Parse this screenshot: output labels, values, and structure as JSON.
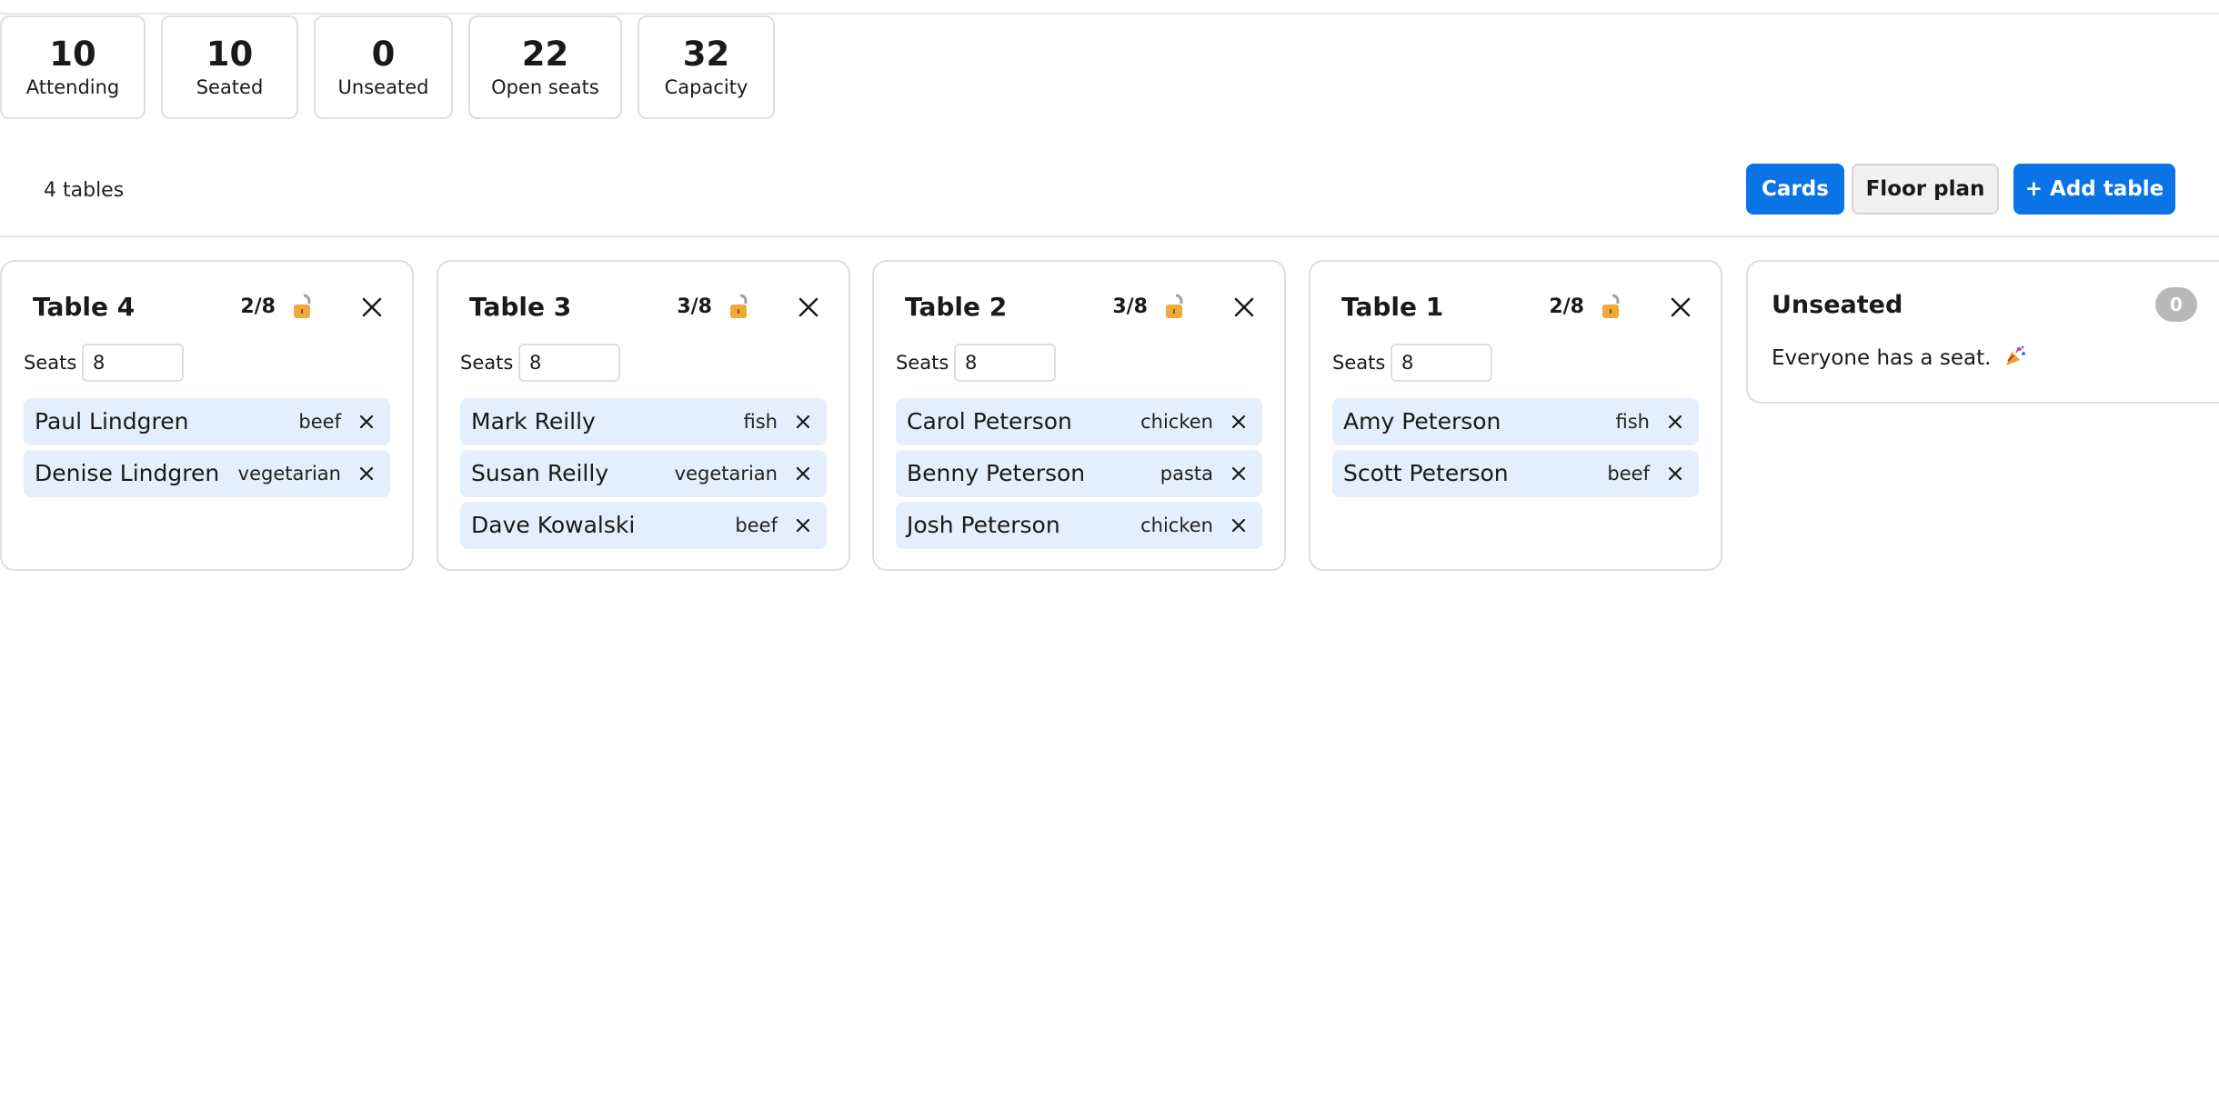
{
  "stats": [
    {
      "value": "10",
      "label": "Attending"
    },
    {
      "value": "10",
      "label": "Seated"
    },
    {
      "value": "0",
      "label": "Unseated"
    },
    {
      "value": "22",
      "label": "Open seats"
    },
    {
      "value": "32",
      "label": "Capacity"
    }
  ],
  "toolbar": {
    "table_count": "4 tables",
    "cards_label": "Cards",
    "floor_plan_label": "Floor plan",
    "add_table_label": "+ Add table"
  },
  "tables": [
    {
      "title": "Table 4",
      "count": "2/8",
      "seats_label": "Seats",
      "seats": "8",
      "guests": [
        {
          "name": "Paul Lindgren",
          "meal": "beef"
        },
        {
          "name": "Denise Lindgren",
          "meal": "vegetarian"
        }
      ]
    },
    {
      "title": "Table 3",
      "count": "3/8",
      "seats_label": "Seats",
      "seats": "8",
      "guests": [
        {
          "name": "Mark Reilly",
          "meal": "fish"
        },
        {
          "name": "Susan Reilly",
          "meal": "vegetarian"
        },
        {
          "name": "Dave Kowalski",
          "meal": "beef"
        }
      ]
    },
    {
      "title": "Table 2",
      "count": "3/8",
      "seats_label": "Seats",
      "seats": "8",
      "guests": [
        {
          "name": "Carol Peterson",
          "meal": "chicken"
        },
        {
          "name": "Benny Peterson",
          "meal": "pasta"
        },
        {
          "name": "Josh Peterson",
          "meal": "chicken"
        }
      ]
    },
    {
      "title": "Table 1",
      "count": "2/8",
      "seats_label": "Seats",
      "seats": "8",
      "guests": [
        {
          "name": "Amy Peterson",
          "meal": "fish"
        },
        {
          "name": "Scott Peterson",
          "meal": "beef"
        }
      ]
    }
  ],
  "unseated": {
    "title": "Unseated",
    "badge": "0",
    "message": "Everyone has a seat."
  },
  "colors": {
    "primary": "#0a74e6",
    "guest_bg": "#e3effc",
    "lock": "#f0a93a",
    "badge_bg": "#b9b9b9"
  },
  "icons": {
    "lock": "unlocked-padlock-icon",
    "close": "close-icon",
    "remove": "remove-x-icon",
    "party": "party-popper-icon"
  }
}
